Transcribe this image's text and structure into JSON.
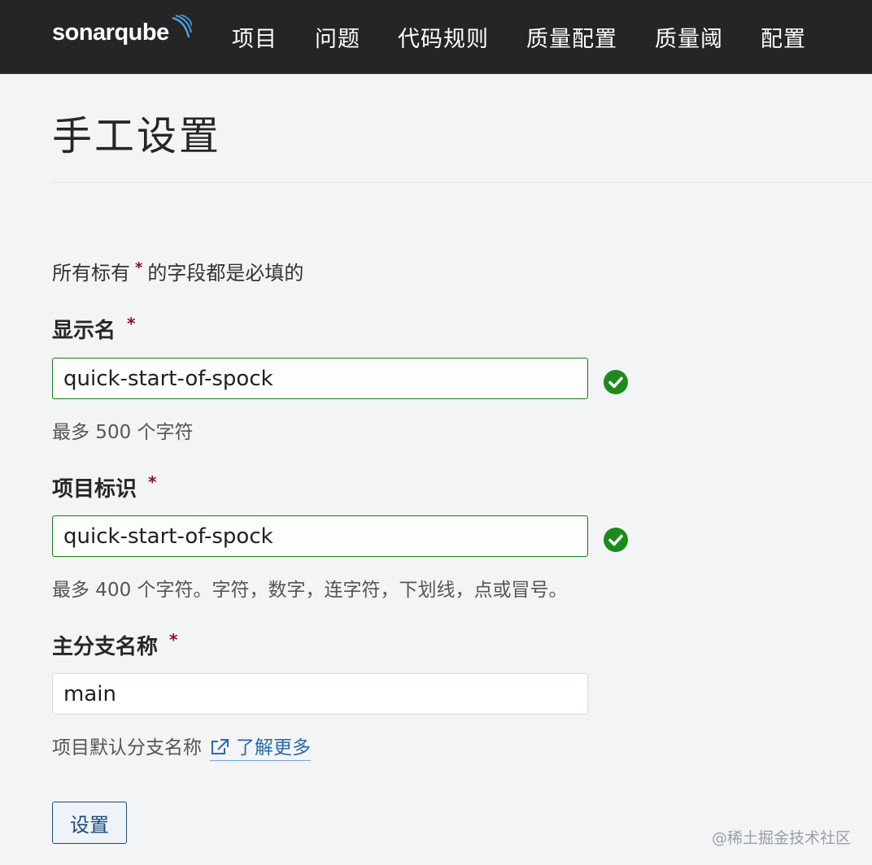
{
  "header": {
    "logo": "sonarqube",
    "nav": [
      "项目",
      "问题",
      "代码规则",
      "质量配置",
      "质量阈",
      "配置"
    ]
  },
  "page": {
    "title": "手工设置",
    "required_note_prefix": "所有标有",
    "required_note_star": "*",
    "required_note_suffix": "的字段都是必填的"
  },
  "form": {
    "display_name": {
      "label": "显示名",
      "required_mark": "*",
      "value": "quick-start-of-spock",
      "help": "最多 500 个字符",
      "valid": true
    },
    "project_key": {
      "label": "项目标识",
      "required_mark": "*",
      "value": "quick-start-of-spock",
      "help": "最多 400 个字符。字符，数字，连字符，下划线，点或冒号。",
      "valid": true
    },
    "main_branch": {
      "label": "主分支名称",
      "required_mark": "*",
      "value": "main",
      "help": "项目默认分支名称",
      "link_text": "了解更多"
    },
    "submit_label": "设置"
  },
  "watermark": "@稀土掘金技术社区",
  "colors": {
    "topbar": "#252525",
    "valid_border": "#1a7a1a",
    "check_icon": "#1e8a1e",
    "required_star": "#8b0f22",
    "link": "#2a6aa8",
    "button_border": "#1d4a7a"
  }
}
